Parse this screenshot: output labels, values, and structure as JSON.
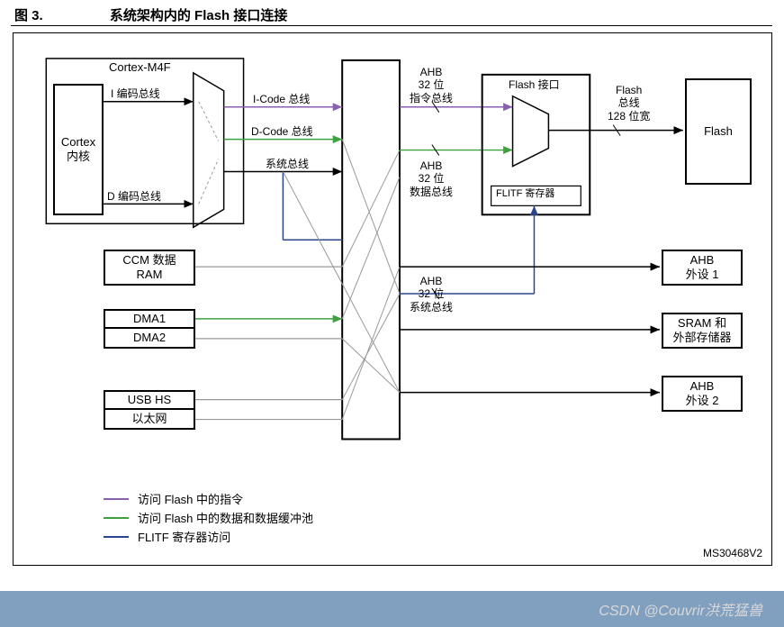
{
  "figure": {
    "number": "图 3.",
    "title": "系统架构内的 Flash 接口连接"
  },
  "blocks": {
    "cortex_m4f": "Cortex-M4F",
    "cortex_core_l1": "Cortex",
    "cortex_core_l2": "内核",
    "i_encode_bus": "I 编码总线",
    "d_encode_bus": "D 编码总线",
    "ccm_l1": "CCM 数据",
    "ccm_l2": "RAM",
    "dma1": "DMA1",
    "dma2": "DMA2",
    "usb_hs": "USB HS",
    "ethernet": "以太网",
    "flash_if": "Flash 接口",
    "flitf_reg": "FLITF 寄存器",
    "flash": "Flash",
    "ahb_periph1_l1": "AHB",
    "ahb_periph1_l2": "外设 1",
    "sram_ext_l1": "SRAM 和",
    "sram_ext_l2": "外部存储器",
    "ahb_periph2_l1": "AHB",
    "ahb_periph2_l2": "外设 2"
  },
  "bus_labels": {
    "icode": "I-Code 总线",
    "dcode": "D-Code 总线",
    "sysbus": "系统总线",
    "ahb_instr_l1": "AHB",
    "ahb_instr_l2": "32 位",
    "ahb_instr_l3": "指令总线",
    "ahb_data_l1": "AHB",
    "ahb_data_l2": "32 位",
    "ahb_data_l3": "数据总线",
    "ahb_sys_l1": "AHB",
    "ahb_sys_l2": "32 位",
    "ahb_sys_l3": "系统总线",
    "flash_bus_l1": "Flash",
    "flash_bus_l2": "总线",
    "flash_bus_l3": "128 位宽"
  },
  "legend": {
    "purple": "访问 Flash 中的指令",
    "green": "访问 Flash 中的数据和数据缓冲池",
    "blue": "FLITF 寄存器访问"
  },
  "colors": {
    "purple": "#8b5fb0",
    "green": "#3fa040",
    "blue": "#2a4590",
    "gray": "#999"
  },
  "doc_id": "MS30468V2",
  "watermark": "CSDN @Couvrir洪荒猛兽"
}
